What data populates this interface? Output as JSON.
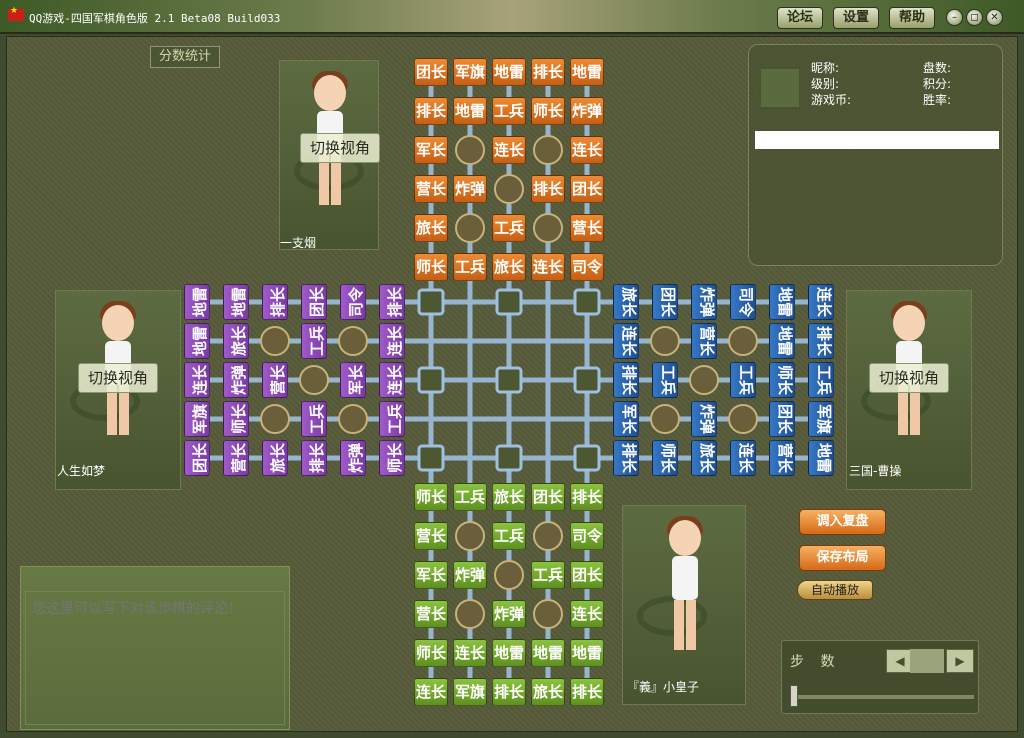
{
  "window": {
    "title": "QQ游戏-四国军棋角色版 2.1 Beta08 Build033",
    "btn_forum": "论坛",
    "btn_settings": "设置",
    "btn_help": "帮助",
    "minimize": "–",
    "restore": "◻",
    "close": "✕"
  },
  "score_stats": "分数统计",
  "switch_view": "切换视角",
  "players": {
    "top": "一支烟",
    "left": "人生如梦",
    "right": "三国-曹操",
    "bottom": "『義』小皇子"
  },
  "info": {
    "nickname": "昵称:",
    "level": "级别:",
    "coins": "游戏币:",
    "games": "盘数:",
    "points": "积分:",
    "winrate": "胜率:"
  },
  "comment_placeholder": "您这里可以写下对该步棋的评论！",
  "buttons": {
    "load": "调入复盘",
    "save": "保存布局",
    "auto": "自动播放"
  },
  "steps_label": "步 数",
  "pieces": {
    "top": [
      [
        "团长",
        "军旗",
        "地雷",
        "排长",
        "地雷"
      ],
      [
        "排长",
        "地雷",
        "工兵",
        "师长",
        "炸弹"
      ],
      [
        "军长",
        "",
        "连长",
        "",
        "连长"
      ],
      [
        "营长",
        "炸弹",
        "",
        "排长",
        "团长"
      ],
      [
        "旅长",
        "",
        "工兵",
        "",
        "营长"
      ],
      [
        "师长",
        "工兵",
        "旅长",
        "连长",
        "司令"
      ]
    ],
    "left": [
      [
        "地雷",
        "地雷",
        "排长",
        "团长",
        "司令",
        "排长"
      ],
      [
        "地雷",
        "旅长",
        "",
        "工兵",
        "",
        "连长"
      ],
      [
        "连长",
        "炸弹",
        "营长",
        "",
        "军长",
        "连长"
      ],
      [
        "军旗",
        "师长",
        "",
        "工兵",
        "",
        "工兵"
      ],
      [
        "团长",
        "营长",
        "旅长",
        "排长",
        "炸弹",
        "师长"
      ]
    ],
    "right": [
      [
        "旅长",
        "团长",
        "炸弹",
        "司令",
        "地雷",
        "连长"
      ],
      [
        "连长",
        "",
        "营长",
        "",
        "地雷",
        "排长"
      ],
      [
        "排长",
        "工兵",
        "",
        "工兵",
        "师长",
        "工兵"
      ],
      [
        "军长",
        "",
        "炸弹",
        "",
        "团长",
        "军旗"
      ],
      [
        "排长",
        "师长",
        "旅长",
        "连长",
        "营长",
        "地雷"
      ]
    ],
    "bottom": [
      [
        "师长",
        "工兵",
        "旅长",
        "团长",
        "排长"
      ],
      [
        "营长",
        "",
        "工兵",
        "",
        "司令"
      ],
      [
        "军长",
        "炸弹",
        "",
        "工兵",
        "团长"
      ],
      [
        "营长",
        "",
        "炸弹",
        "",
        "连长"
      ],
      [
        "师长",
        "连长",
        "地雷",
        "地雷",
        "地雷"
      ],
      [
        "连长",
        "军旗",
        "排长",
        "旅长",
        "排长"
      ]
    ]
  }
}
